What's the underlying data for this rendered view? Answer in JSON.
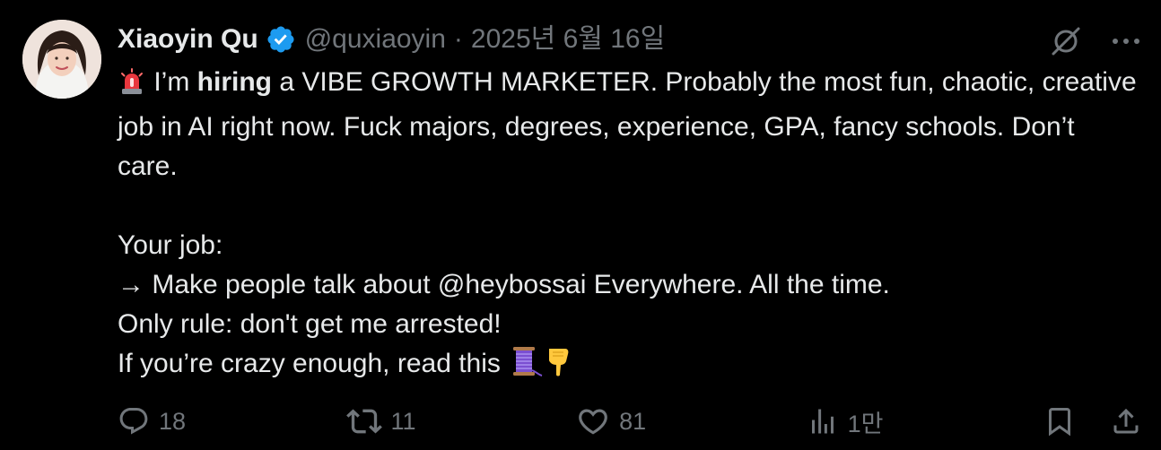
{
  "tweet": {
    "author": {
      "display_name": "Xiaoyin Qu",
      "handle": "@quxiaoyin",
      "verified": true,
      "verified_color": "#1d9bf0"
    },
    "separator": "·",
    "date": "2025년 6월 16일",
    "body": {
      "line1_pre": " I’m ",
      "line1_bold": "hiring",
      "line1_post": " a VIBE GROWTH MARKETER. Probably the most fun, chaotic, creative job in AI right now. Fuck majors, degrees, experience, GPA, fancy schools. Don’t care.",
      "your_job": "Your job:",
      "line_arrow": "→ Make people talk about @heybossai Everywhere. All the time.",
      "line_rule": "Only rule: don't get me arrested!",
      "line_crazy": "If you’re crazy enough, read this ",
      "emojis": [
        "rotating-light",
        "thread-spool",
        "pointing-down"
      ]
    },
    "actions": {
      "replies": "18",
      "reposts": "11",
      "likes": "81",
      "views": "1만"
    },
    "icons": {
      "grok": "grok-icon",
      "more": "more-icon",
      "reply": "reply-icon",
      "repost": "repost-icon",
      "like": "like-icon",
      "views": "views-icon",
      "bookmark": "bookmark-icon",
      "share": "share-icon"
    },
    "colors": {
      "background": "#000000",
      "text": "#e7e9ea",
      "muted": "#71767b"
    }
  }
}
